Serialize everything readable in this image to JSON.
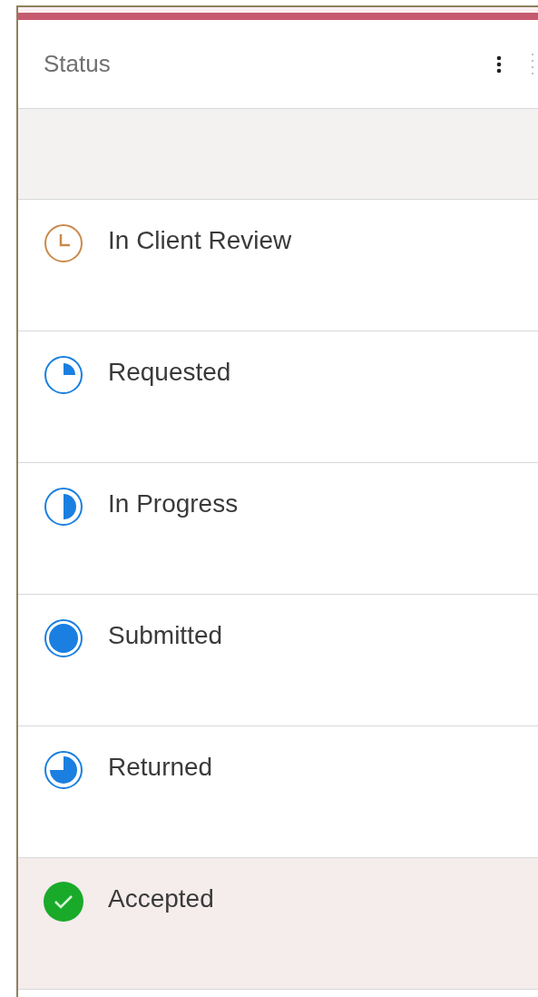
{
  "column": {
    "title": "Status"
  },
  "rows": [
    {
      "label": "In Client Review",
      "kind": "clock",
      "selected": false
    },
    {
      "label": "Requested",
      "kind": "quarter",
      "selected": false
    },
    {
      "label": "In Progress",
      "kind": "half",
      "selected": false
    },
    {
      "label": "Submitted",
      "kind": "full",
      "selected": false
    },
    {
      "label": "Returned",
      "kind": "three-quarter",
      "selected": false
    },
    {
      "label": "Accepted",
      "kind": "check",
      "selected": true
    }
  ]
}
